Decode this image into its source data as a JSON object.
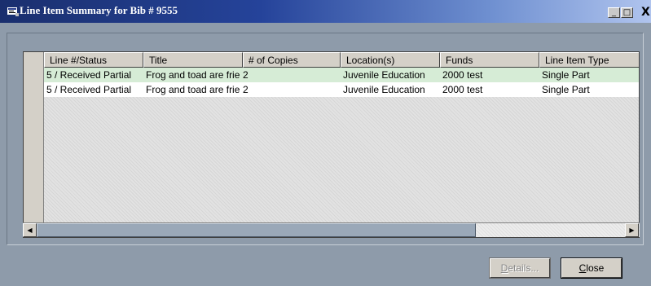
{
  "window": {
    "title": "Line Item Summary for Bib # 9555",
    "controls": {
      "minimize": "_",
      "maximize": "□",
      "close": "X"
    }
  },
  "table": {
    "columns": [
      "Line #/Status",
      "Title",
      "# of Copies",
      "Location(s)",
      "Funds",
      "Line Item Type"
    ],
    "rows": [
      {
        "status": "5 / Received Partial",
        "title": "Frog and toad are frie",
        "copies": "2",
        "location": "Juvenile Education",
        "funds": "2000 test",
        "type": "Single Part",
        "selected": true
      },
      {
        "status": "5 / Received Partial",
        "title": "Frog and toad are frie",
        "copies": "2",
        "location": "Juvenile Education",
        "funds": "2000 test",
        "type": "Single Part",
        "selected": false
      }
    ]
  },
  "scrollbar": {
    "left_arrow": "◀",
    "right_arrow": "▶"
  },
  "buttons": {
    "details_first": "D",
    "details_rest": "etails...",
    "close_first": "C",
    "close_rest": "lose"
  },
  "colors": {
    "titlebar_start": "#1a2f6e",
    "titlebar_end": "#b0c4ee",
    "selected_row": "#d6ecd6",
    "window_bg": "#8e9baa"
  }
}
